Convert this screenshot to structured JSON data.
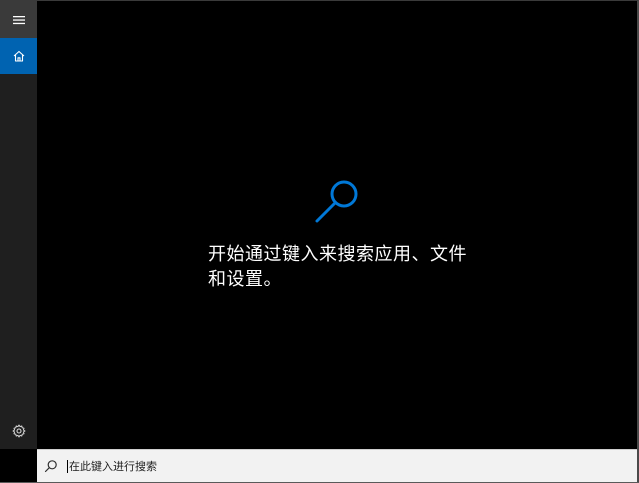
{
  "sidebar": {
    "menu_icon": "hamburger-icon",
    "home_icon": "home-icon",
    "settings_icon": "gear-icon"
  },
  "main": {
    "hero_icon": "search-icon",
    "hero_text": "开始通过键入来搜索应用、文件和设置。"
  },
  "searchbar": {
    "icon": "search-icon",
    "placeholder": "在此键入进行搜索"
  },
  "colors": {
    "accent": "#0063b1",
    "hero_icon": "#0078d7",
    "sidebar_bg": "#1f1f1f",
    "menu_bg": "#3a3a3a",
    "main_bg": "#000000",
    "searchbar_bg": "#f2f2f2"
  }
}
